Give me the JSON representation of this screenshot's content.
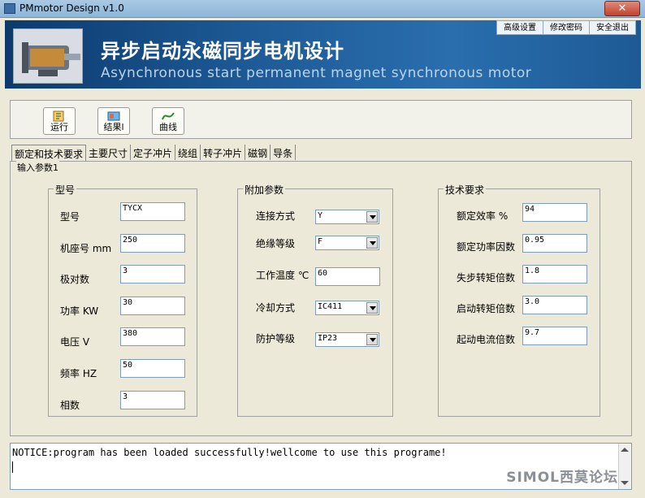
{
  "window": {
    "title": "PMmotor Design v1.0",
    "close_label": "✕"
  },
  "banner": {
    "title": "异步启动永磁同步电机设计",
    "subtitle": "Asynchronous start permanent magnet synchronous motor",
    "links": [
      "高级设置",
      "修改密码",
      "安全退出"
    ]
  },
  "toolbar": {
    "run": "运行",
    "result": "结果l",
    "curve": "曲线"
  },
  "tabs": [
    "额定和技术要求",
    "主要尺寸",
    "定子冲片",
    "绕组",
    "转子冲片",
    "磁钢",
    "导条"
  ],
  "panel": {
    "legend": "输入参数1"
  },
  "model_group": {
    "legend": "型号",
    "fields": [
      {
        "label": "型号",
        "value": "TYCX"
      },
      {
        "label": "机座号 mm",
        "value": "250"
      },
      {
        "label": "极对数",
        "value": "3"
      },
      {
        "label": "功率 KW",
        "value": "30"
      },
      {
        "label": "电压 V",
        "value": "380"
      },
      {
        "label": "频率 HZ",
        "value": "50"
      },
      {
        "label": "相数",
        "value": "3"
      }
    ]
  },
  "extra_group": {
    "legend": "附加参数",
    "connection": {
      "label": "连接方式",
      "value": "Y"
    },
    "insulation": {
      "label": "绝缘等级",
      "value": "F"
    },
    "temperature": {
      "label": "工作温度 ℃",
      "value": "60"
    },
    "cooling": {
      "label": "冷却方式",
      "value": "IC411"
    },
    "protection": {
      "label": "防护等级",
      "value": "IP23"
    }
  },
  "tech_group": {
    "legend": "技术要求",
    "fields": [
      {
        "label": "额定效率 %",
        "value": "94"
      },
      {
        "label": "额定功率因数",
        "value": "0.95"
      },
      {
        "label": "失步转矩倍数",
        "value": "1.8"
      },
      {
        "label": "启动转矩倍数",
        "value": "3.0"
      },
      {
        "label": "起动电流倍数",
        "value": "9.7"
      }
    ]
  },
  "notice": {
    "text": "NOTICE:program has been loaded successfully!wellcome to use this programe!"
  },
  "watermark": "SIMOL西莫论坛",
  "colors": {
    "banner": "#1e5b97",
    "window_bg": "#ece9d8",
    "field_border": "#7f9db9"
  }
}
